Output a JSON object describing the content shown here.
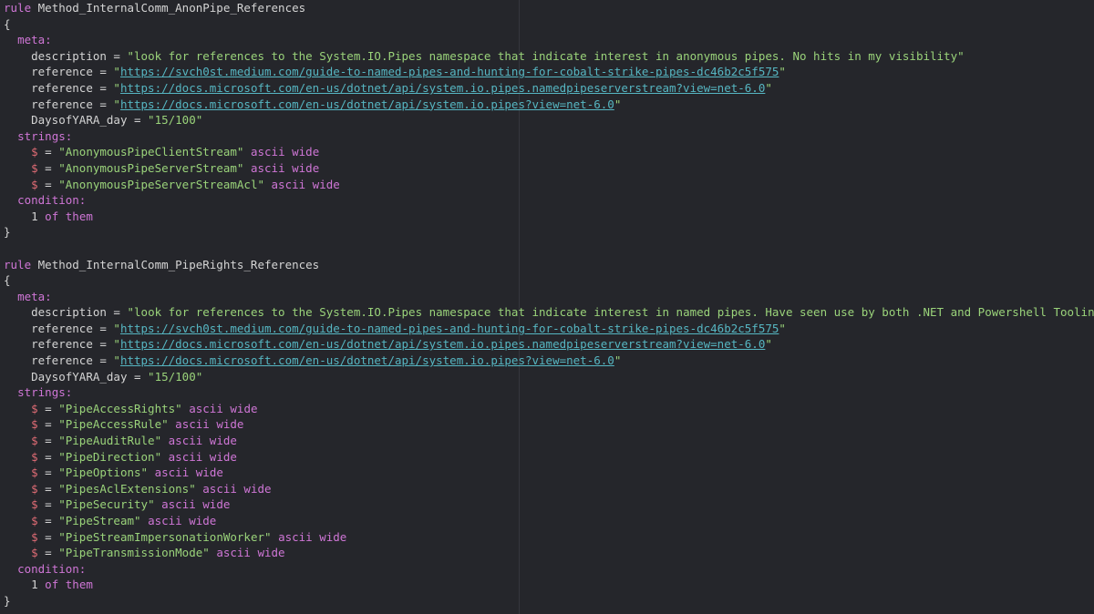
{
  "rules": [
    {
      "keyword": "rule",
      "name": "Method_InternalComm_AnonPipe_References",
      "meta_label": "meta:",
      "meta": [
        {
          "key": "description",
          "value": "look for references to the System.IO.Pipes namespace that indicate interest in anonymous pipes. No hits in my visibility",
          "is_url": false
        },
        {
          "key": "reference",
          "value": "https://svch0st.medium.com/guide-to-named-pipes-and-hunting-for-cobalt-strike-pipes-dc46b2c5f575",
          "is_url": true
        },
        {
          "key": "reference",
          "value": "https://docs.microsoft.com/en-us/dotnet/api/system.io.pipes.namedpipeserverstream?view=net-6.0",
          "is_url": true
        },
        {
          "key": "reference",
          "value": "https://docs.microsoft.com/en-us/dotnet/api/system.io.pipes?view=net-6.0",
          "is_url": true
        },
        {
          "key": "DaysofYARA_day",
          "value": "15/100",
          "is_url": false
        }
      ],
      "strings_label": "strings:",
      "strings": [
        {
          "var": "$",
          "value": "AnonymousPipeClientStream",
          "modifiers": "ascii wide"
        },
        {
          "var": "$",
          "value": "AnonymousPipeServerStream",
          "modifiers": "ascii wide"
        },
        {
          "var": "$",
          "value": "AnonymousPipeServerStreamAcl",
          "modifiers": "ascii wide"
        }
      ],
      "condition_label": "condition:",
      "condition": {
        "count": "1",
        "of": "of",
        "them": "them"
      }
    },
    {
      "keyword": "rule",
      "name": "Method_InternalComm_PipeRights_References",
      "meta_label": "meta:",
      "meta": [
        {
          "key": "description",
          "value": "look for references to the System.IO.Pipes namespace that indicate interest in named pipes. Have seen use by both .NET and Powershell Tooling",
          "is_url": false
        },
        {
          "key": "reference",
          "value": "https://svch0st.medium.com/guide-to-named-pipes-and-hunting-for-cobalt-strike-pipes-dc46b2c5f575",
          "is_url": true
        },
        {
          "key": "reference",
          "value": "https://docs.microsoft.com/en-us/dotnet/api/system.io.pipes.namedpipeserverstream?view=net-6.0",
          "is_url": true
        },
        {
          "key": "reference",
          "value": "https://docs.microsoft.com/en-us/dotnet/api/system.io.pipes?view=net-6.0",
          "is_url": true
        },
        {
          "key": "DaysofYARA_day",
          "value": "15/100",
          "is_url": false
        }
      ],
      "strings_label": "strings:",
      "strings": [
        {
          "var": "$",
          "value": "PipeAccessRights",
          "modifiers": "ascii wide"
        },
        {
          "var": "$",
          "value": "PipeAccessRule",
          "modifiers": "ascii wide"
        },
        {
          "var": "$",
          "value": "PipeAuditRule",
          "modifiers": "ascii wide"
        },
        {
          "var": "$",
          "value": "PipeDirection",
          "modifiers": "ascii wide"
        },
        {
          "var": "$",
          "value": "PipeOptions",
          "modifiers": "ascii wide"
        },
        {
          "var": "$",
          "value": "PipesAclExtensions",
          "modifiers": "ascii wide"
        },
        {
          "var": "$",
          "value": "PipeSecurity",
          "modifiers": "ascii wide"
        },
        {
          "var": "$",
          "value": "PipeStream",
          "modifiers": "ascii wide"
        },
        {
          "var": "$",
          "value": "PipeStreamImpersonationWorker",
          "modifiers": "ascii wide"
        },
        {
          "var": "$",
          "value": "PipeTransmissionMode",
          "modifiers": "ascii wide"
        }
      ],
      "condition_label": "condition:",
      "condition": {
        "count": "1",
        "of": "of",
        "them": "them"
      }
    }
  ],
  "colors": {
    "background": "#25262b",
    "keyword": "#cf76d6",
    "string": "#9ad37a",
    "url": "#56b6c2",
    "variable": "#e06c75",
    "text": "#d4d4d4"
  }
}
